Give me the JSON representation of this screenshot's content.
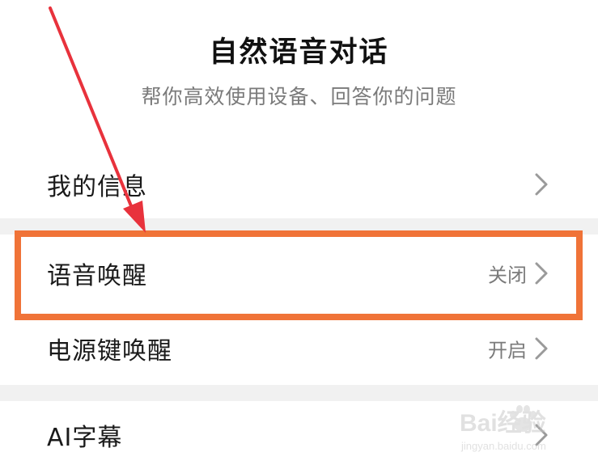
{
  "header": {
    "title": "自然语音对话",
    "subtitle": "帮你高效使用设备、回答你的问题"
  },
  "settings": {
    "items": [
      {
        "label": "我的信息",
        "value": ""
      },
      {
        "label": "语音唤醒",
        "value": "关闭"
      },
      {
        "label": "电源键唤醒",
        "value": "开启"
      },
      {
        "label": "AI字幕",
        "value": ""
      }
    ]
  },
  "annotations": {
    "highlight_color": "#f07338",
    "arrow_color": "#e8323c"
  },
  "icons": {
    "chevron": "chevron-right-icon",
    "watermark": "baidu-paw-icon"
  },
  "watermark": {
    "brand": "Bai经验",
    "url": "jingyan.baidu.com"
  },
  "colors": {
    "background": "#ffffff",
    "separator": "#f1f1f1",
    "primary_text": "#1a1a1a",
    "secondary_text": "#7a7a7a"
  }
}
